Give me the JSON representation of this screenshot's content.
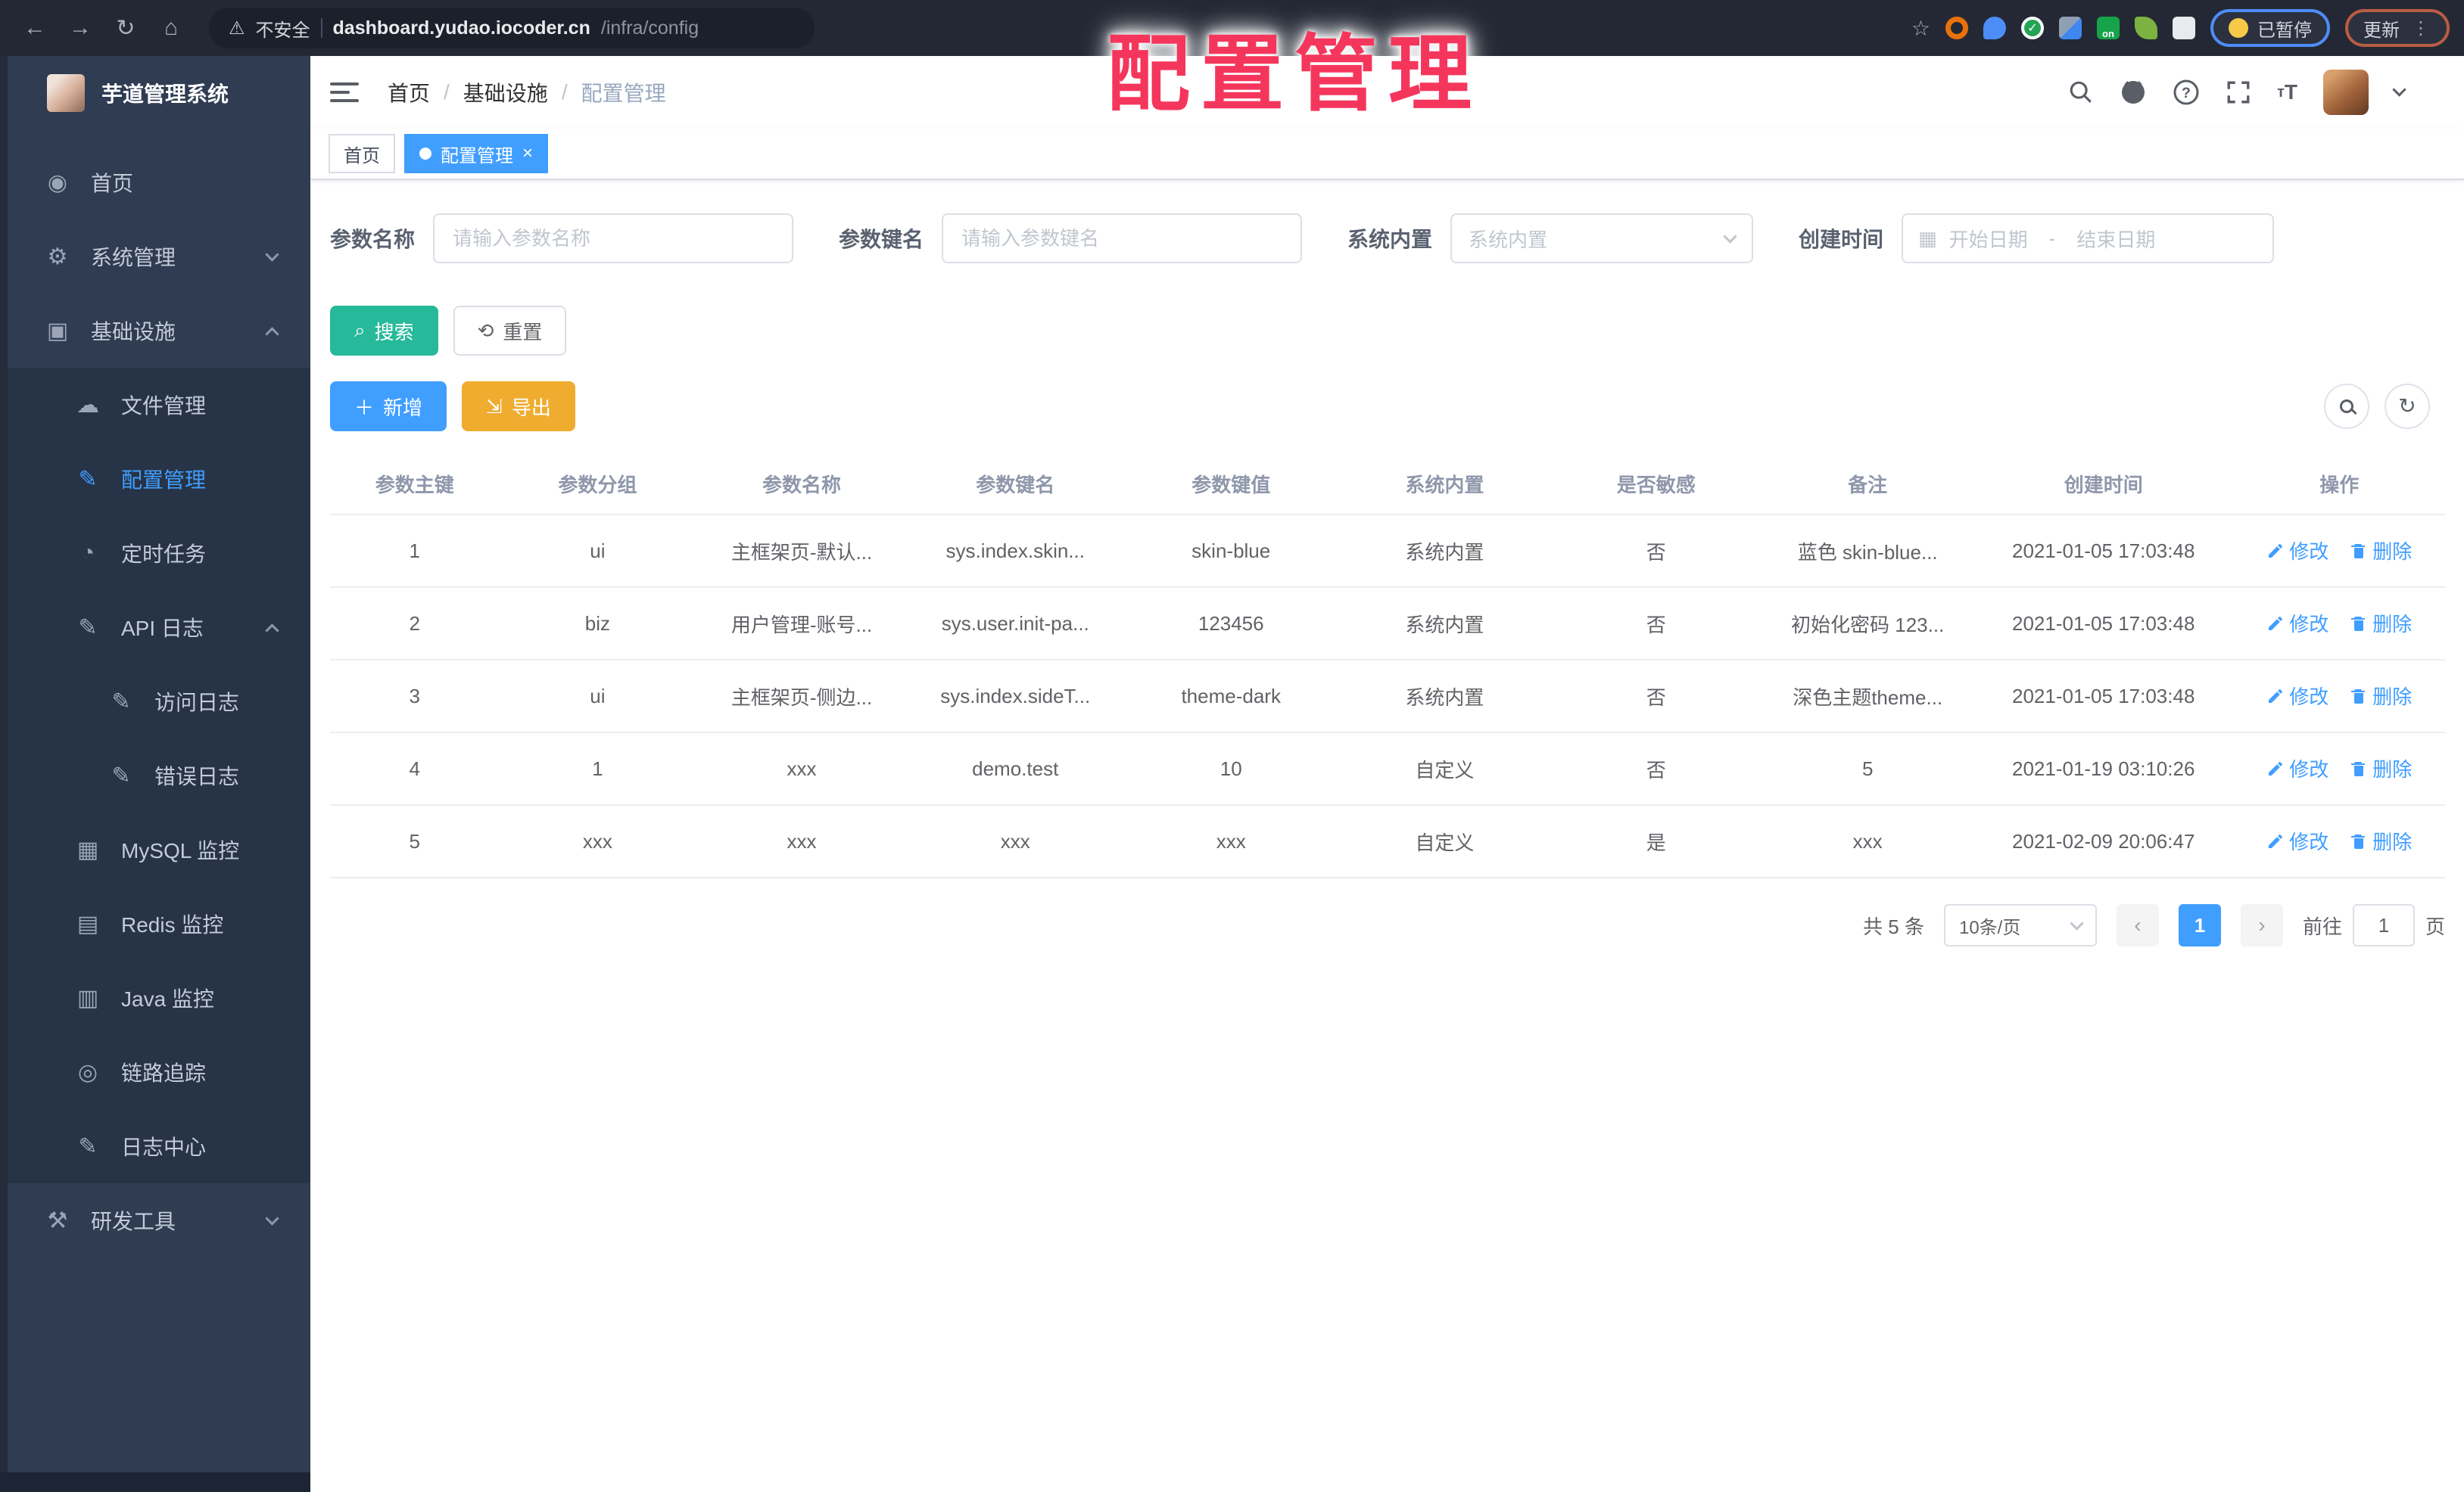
{
  "browser": {
    "security_warning": "不安全",
    "url_host": "dashboard.yudao.iocoder.cn",
    "url_path": "/infra/config",
    "paused_badge": "已暂停",
    "update_button": "更新"
  },
  "annotation": {
    "text": "配置管理"
  },
  "sidebar": {
    "title": "芋道管理系统",
    "items": [
      {
        "name": "home",
        "label": "首页",
        "icon": "dashboard-icon",
        "level": 0,
        "glyph": "◉"
      },
      {
        "name": "system",
        "label": "系统管理",
        "icon": "gear-icon",
        "level": 0,
        "glyph": "⚙",
        "chevron": "down"
      },
      {
        "name": "infra",
        "label": "基础设施",
        "icon": "monitor-icon",
        "level": 0,
        "glyph": "▣",
        "chevron": "up"
      },
      {
        "name": "file",
        "label": "文件管理",
        "icon": "cloud-icon",
        "level": 1,
        "glyph": "☁"
      },
      {
        "name": "config",
        "label": "配置管理",
        "icon": "edit-icon",
        "level": 1,
        "glyph": "✎",
        "active": true
      },
      {
        "name": "job",
        "label": "定时任务",
        "icon": "timer-icon",
        "level": 1,
        "glyph": "◔"
      },
      {
        "name": "api-log",
        "label": "API 日志",
        "icon": "log-icon",
        "level": 1,
        "glyph": "✎",
        "chevron": "up"
      },
      {
        "name": "access-log",
        "label": "访问日志",
        "icon": "log-icon",
        "level": 2,
        "glyph": "✎"
      },
      {
        "name": "error-log",
        "label": "错误日志",
        "icon": "log-icon",
        "level": 2,
        "glyph": "✎"
      },
      {
        "name": "mysql",
        "label": "MySQL 监控",
        "icon": "mysql-icon",
        "level": 1,
        "glyph": "▦"
      },
      {
        "name": "redis",
        "label": "Redis 监控",
        "icon": "redis-icon",
        "level": 1,
        "glyph": "▤"
      },
      {
        "name": "java",
        "label": "Java 监控",
        "icon": "java-icon",
        "level": 1,
        "glyph": "▥"
      },
      {
        "name": "trace",
        "label": "链路追踪",
        "icon": "eye-icon",
        "level": 1,
        "glyph": "◎"
      },
      {
        "name": "log-center",
        "label": "日志中心",
        "icon": "log-icon",
        "level": 1,
        "glyph": "✎"
      },
      {
        "name": "tools",
        "label": "研发工具",
        "icon": "tools-icon",
        "level": 0,
        "glyph": "⚒",
        "chevron": "down"
      }
    ]
  },
  "breadcrumb": {
    "items": [
      "首页",
      "基础设施",
      "配置管理"
    ]
  },
  "tags": {
    "first": "首页",
    "active": "配置管理"
  },
  "filters": {
    "name": {
      "label": "参数名称",
      "placeholder": "请输入参数名称"
    },
    "key": {
      "label": "参数键名",
      "placeholder": "请输入参数键名"
    },
    "builtin": {
      "label": "系统内置",
      "placeholder": "系统内置"
    },
    "created": {
      "label": "创建时间",
      "start_placeholder": "开始日期",
      "separator": "-",
      "end_placeholder": "结束日期"
    }
  },
  "toolbar": {
    "search": "搜索",
    "reset": "重置",
    "add": "新增",
    "export": "导出"
  },
  "table": {
    "columns": [
      "参数主键",
      "参数分组",
      "参数名称",
      "参数键名",
      "参数键值",
      "系统内置",
      "是否敏感",
      "备注",
      "创建时间",
      "操作"
    ],
    "rows": [
      [
        "1",
        "ui",
        "主框架页-默认...",
        "sys.index.skin...",
        "skin-blue",
        "系统内置",
        "否",
        "蓝色 skin-blue...",
        "2021-01-05 17:03:48"
      ],
      [
        "2",
        "biz",
        "用户管理-账号...",
        "sys.user.init-pa...",
        "123456",
        "系统内置",
        "否",
        "初始化密码 123...",
        "2021-01-05 17:03:48"
      ],
      [
        "3",
        "ui",
        "主框架页-侧边...",
        "sys.index.sideT...",
        "theme-dark",
        "系统内置",
        "否",
        "深色主题theme...",
        "2021-01-05 17:03:48"
      ],
      [
        "4",
        "1",
        "xxx",
        "demo.test",
        "10",
        "自定义",
        "否",
        "5",
        "2021-01-19 03:10:26"
      ],
      [
        "5",
        "xxx",
        "xxx",
        "xxx",
        "xxx",
        "自定义",
        "是",
        "xxx",
        "2021-02-09 20:06:47"
      ]
    ],
    "ops": {
      "edit": "修改",
      "delete": "删除"
    }
  },
  "pagination": {
    "total": "共 5 条",
    "page_size": "10条/页",
    "current": "1",
    "goto_label": "前往",
    "goto_value": "1",
    "page_suffix": "页"
  }
}
